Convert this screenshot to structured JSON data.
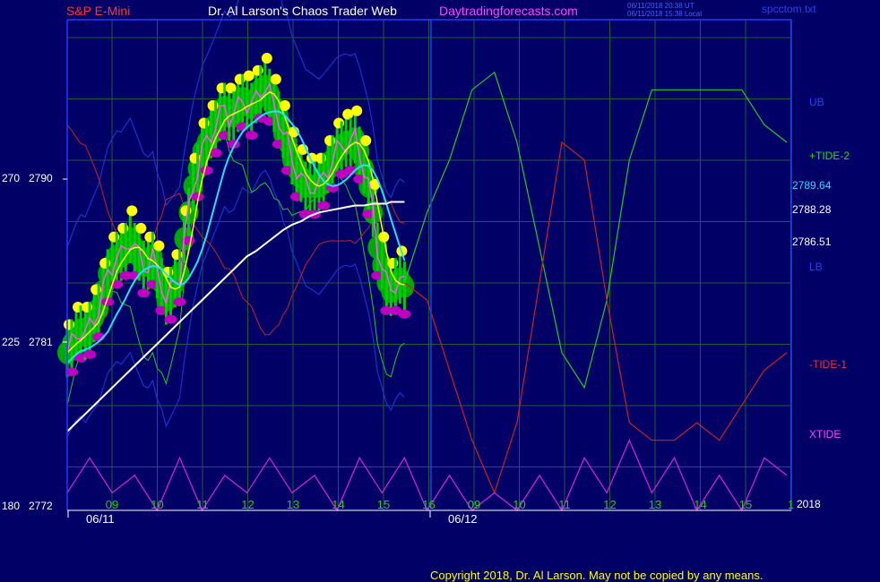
{
  "header": {
    "symbol": "S&P E-Mini",
    "author": "Dr. Al Larson's Chaos Trader Web",
    "site": "Daytradingforecasts.com",
    "timestamp_utc": "06/11/2018 20:38 UT",
    "timestamp_local": "06/11/2018 15:38 Local",
    "filename": "spcctom.txt"
  },
  "footer": {
    "copyright": "Copyright 2018, Dr. Al Larson. May not be copied by any means."
  },
  "colors": {
    "background": "#000066",
    "grid": "#1b5e3a",
    "axis": "#1e3cff",
    "price_bar": "#00d000",
    "price_body": "#00b000",
    "highs": "#ffff00",
    "lows": "#c000c0",
    "ub_lb": "#2030d0",
    "tide_plus": "#22cc22",
    "tide_minus": "#cc2222",
    "xtide": "#dd22dd",
    "ma_fast": "#ffff00",
    "ma_mid": "#22e0ff",
    "ma_slow": "#ffffff",
    "ma_short": "#ff55ff"
  },
  "chart_data": {
    "type": "line",
    "title": "S&P E-Mini",
    "x_axis": {
      "labels": [
        "09",
        "10",
        "11",
        "12",
        "13",
        "14",
        "15",
        "16",
        "09",
        "10",
        "11",
        "12",
        "13",
        "14",
        "15",
        "1"
      ],
      "date_labels": [
        "06/11",
        "06/12"
      ],
      "range": [
        8.5,
        24.6
      ],
      "year": "2018"
    },
    "y_axis": {
      "left_labels": [
        {
          "osc": "270",
          "price": "2790"
        },
        {
          "osc": "225",
          "price": "2781"
        },
        {
          "osc": "180",
          "price": "2772"
        }
      ],
      "range": [
        2772,
        2800
      ]
    },
    "right_labels": [
      {
        "text": "UB",
        "color": "#2a40ff"
      },
      {
        "text": "+TIDE-2",
        "color": "#22dd22"
      },
      {
        "text": "2789.64",
        "color": "#22e0ff"
      },
      {
        "text": "2788.28",
        "color": "#ffffff"
      },
      {
        "text": "2786.51",
        "color": "#ffffff"
      },
      {
        "text": "LB",
        "color": "#2a40ff"
      },
      {
        "text": "-TIDE-1",
        "color": "#ee3333"
      },
      {
        "text": "XTIDE",
        "color": "#ff44ff"
      },
      {
        "text": "2018",
        "color": "#ffffff"
      }
    ],
    "price_data": {
      "x": [
        8.5,
        8.6,
        8.7,
        8.8,
        8.9,
        9.0,
        9.1,
        9.2,
        9.3,
        9.4,
        9.5,
        9.6,
        9.7,
        9.8,
        9.9,
        10.0,
        10.1,
        10.2,
        10.3,
        10.4,
        10.5,
        10.6,
        10.7,
        10.8,
        10.9,
        11.0,
        11.1,
        11.2,
        11.3,
        11.4,
        11.5,
        11.6,
        11.7,
        11.8,
        11.9,
        12.0,
        12.1,
        12.2,
        12.3,
        12.4,
        12.5,
        12.6,
        12.7,
        12.8,
        12.9,
        13.0,
        13.1,
        13.2,
        13.3,
        13.4,
        13.5,
        13.6,
        13.7,
        13.8,
        13.9,
        14.0,
        14.1,
        14.2,
        14.3,
        14.4,
        14.5,
        14.6,
        14.7,
        14.8,
        14.9,
        15.0,
        15.1,
        15.2,
        15.3,
        15.4,
        15.5,
        15.6,
        15.7,
        15.8,
        15.9,
        16.0
      ],
      "close": [
        2781.0,
        2781.5,
        2782.0,
        2782.3,
        2782.0,
        2782.5,
        2783.0,
        2783.5,
        2784.5,
        2785.5,
        2786.0,
        2786.5,
        2786.5,
        2787.0,
        2787.5,
        2787.0,
        2786.5,
        2786.0,
        2786.0,
        2786.5,
        2785.5,
        2785.0,
        2784.0,
        2784.5,
        2785.0,
        2785.5,
        2787.5,
        2789.0,
        2790.5,
        2791.5,
        2792.5,
        2793.0,
        2793.5,
        2794.0,
        2794.5,
        2795.0,
        2794.5,
        2794.5,
        2795.0,
        2795.5,
        2795.2,
        2795.0,
        2795.5,
        2796.0,
        2796.2,
        2795.8,
        2795.0,
        2794.5,
        2793.5,
        2793.0,
        2792.0,
        2791.5,
        2791.0,
        2790.5,
        2790.5,
        2790.5,
        2790.5,
        2791.0,
        2791.5,
        2792.0,
        2792.5,
        2792.8,
        2793.0,
        2793.0,
        2793.2,
        2792.5,
        2791.5,
        2790.5,
        2789.0,
        2787.0,
        2786.0,
        2785.0,
        2784.5,
        2785.0,
        2785.2,
        2784.8
      ],
      "ma_slow": [
        2776.5,
        2777.0,
        2777.5,
        2778.0,
        2778.5,
        2779.0,
        2779.5,
        2780.0,
        2780.5,
        2781.0,
        2781.5,
        2782.0,
        2782.5,
        2783.0,
        2783.5,
        2784.0,
        2784.5,
        2785.0,
        2785.5,
        2786.0,
        2786.5,
        2786.8,
        2787.2,
        2787.6,
        2788.0,
        2788.3,
        2788.5,
        2788.8,
        2789.0,
        2789.1,
        2789.2,
        2789.3,
        2789.4,
        2789.4,
        2789.5,
        2789.5,
        2789.5,
        2789.6,
        2789.6,
        2789.6,
        2789.6,
        2789.6,
        2789.6,
        2789.6,
        2789.6,
        2789.6
      ],
      "ma_slow_x": [
        8.5,
        8.7,
        8.9,
        9.1,
        9.3,
        9.5,
        9.7,
        9.9,
        10.1,
        10.3,
        10.5,
        10.7,
        10.9,
        11.1,
        11.3,
        11.5,
        11.7,
        11.9,
        12.1,
        12.3,
        12.5,
        12.7,
        12.9,
        13.1,
        13.3,
        13.5,
        13.7,
        13.9,
        14.1,
        14.3,
        14.5,
        14.7,
        14.9,
        15.1,
        15.3,
        15.5,
        15.6,
        15.7,
        15.8,
        15.9,
        16.0,
        16.0,
        16.0,
        16.0,
        16.0,
        16.0
      ]
    },
    "series": [
      {
        "name": "+TIDE-2",
        "color": "#22cc22",
        "x": [
          16.0,
          16.5,
          17.0,
          17.5,
          18.0,
          18.5,
          19.0,
          19.5,
          20.0,
          20.5,
          21.0,
          21.5,
          22.0,
          22.5,
          23.0,
          23.5,
          24.0,
          24.5
        ],
        "y": [
          2785,
          2789,
          2792,
          2796,
          2797,
          2793,
          2787,
          2781,
          2779,
          2784,
          2792,
          2796,
          2796,
          2796,
          2796,
          2796,
          2794,
          2793
        ]
      },
      {
        "name": "-TIDE-1",
        "color": "#cc2222",
        "x": [
          16.0,
          16.5,
          17.0,
          17.5,
          18.0,
          18.5,
          19.0,
          19.5,
          20.0,
          20.5,
          21.0,
          21.5,
          22.0,
          22.5,
          23.0,
          23.5,
          24.0,
          24.5
        ],
        "y": [
          2785,
          2784,
          2780,
          2776,
          2773,
          2777,
          2785,
          2793,
          2792,
          2784,
          2777,
          2776,
          2776,
          2777,
          2776,
          2778,
          2780,
          2781
        ]
      },
      {
        "name": "XTIDE",
        "color": "#dd22dd",
        "x": [
          8.5,
          9.0,
          9.5,
          10.0,
          10.5,
          11.0,
          11.5,
          12.0,
          12.5,
          13.0,
          13.5,
          14.0,
          14.5,
          15.0,
          15.5,
          16.0,
          16.5,
          17.0,
          17.5,
          18.0,
          18.5,
          19.0,
          19.5,
          20.0,
          20.5,
          21.0,
          21.5,
          22.0,
          22.5,
          23.0,
          23.5,
          24.0,
          24.5
        ],
        "y": [
          2773,
          2775,
          2773,
          2774,
          2772,
          2775,
          2772,
          2774,
          2773,
          2775,
          2773,
          2774,
          2772,
          2775,
          2773,
          2775,
          2772,
          2774,
          2772,
          2773,
          2772,
          2774,
          2772,
          2775,
          2773,
          2776,
          2773,
          2775,
          2772,
          2774,
          2772,
          2775,
          2774
        ]
      }
    ]
  }
}
